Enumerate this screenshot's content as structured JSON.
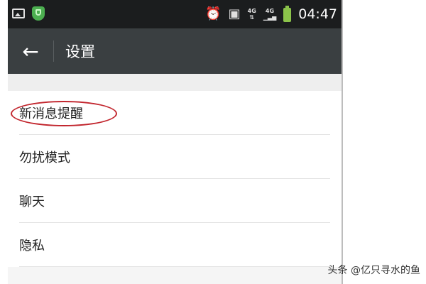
{
  "status_bar": {
    "left_icons": [
      "image-icon",
      "shield-icon"
    ],
    "right_icons": [
      "alarm-icon",
      "sim-icon",
      "4g-icon",
      "signal-icon",
      "battery-icon"
    ],
    "network_label": "4G",
    "signal_label": "4G",
    "time": "04:47"
  },
  "title_bar": {
    "back_icon": "arrow-left-icon",
    "title": "设置"
  },
  "settings": {
    "items": [
      {
        "label": "新消息提醒"
      },
      {
        "label": "勿扰模式"
      },
      {
        "label": "聊天"
      },
      {
        "label": "隐私"
      }
    ]
  },
  "watermark": "头条 @亿只寻水的鱼",
  "colors": {
    "status_bar_bg": "#1b1d1e",
    "title_bar_bg": "#3a3f41",
    "highlight_ring": "#c2262e",
    "battery": "#8bc34a"
  }
}
